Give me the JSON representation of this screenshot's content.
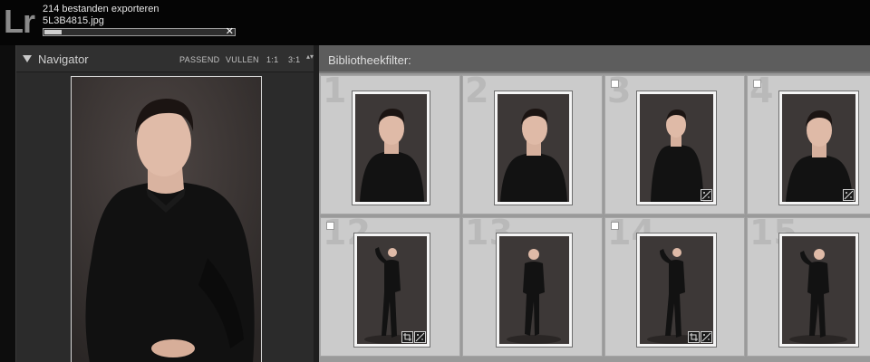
{
  "app": {
    "logo": "Lr"
  },
  "task": {
    "title": "214 bestanden exporteren",
    "file": "5L3B4815.jpg",
    "progress": 0.09,
    "cancel": "✕"
  },
  "navigator": {
    "title": "Navigator",
    "zoom_options": [
      "PASSEND",
      "VULLEN",
      "1:1",
      "3:1"
    ],
    "zoom_more": "▴▾"
  },
  "library_filter": {
    "label": "Bibliotheekfilter:"
  },
  "grid": {
    "cells": [
      {
        "number": "1",
        "flag": false,
        "badge": false
      },
      {
        "number": "2",
        "flag": false,
        "badge": false
      },
      {
        "number": "3",
        "flag": true,
        "badge": true
      },
      {
        "number": "4",
        "flag": true,
        "badge": true
      },
      {
        "number": "12",
        "flag": true,
        "badge": true
      },
      {
        "number": "13",
        "flag": false,
        "badge": false
      },
      {
        "number": "14",
        "flag": true,
        "badge": true
      },
      {
        "number": "15",
        "flag": false,
        "badge": false
      }
    ]
  },
  "colors": {
    "background": "#050505",
    "panel": "#2b2b2b",
    "grid_cell": "#cbcbcb",
    "photo_backdrop": "#3a3534"
  }
}
